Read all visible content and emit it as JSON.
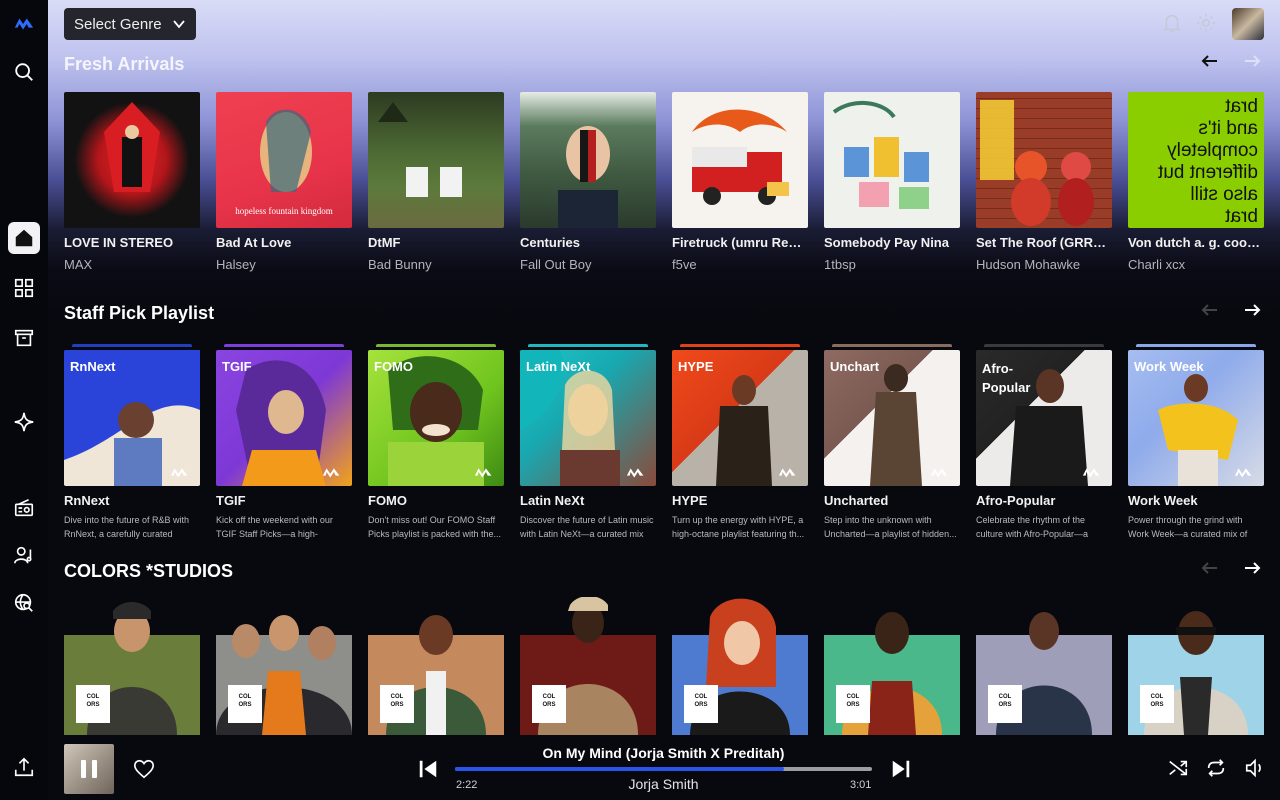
{
  "header": {
    "genre_select": "Select Genre"
  },
  "icons": {
    "logo": "logo-icon",
    "search": "search-icon",
    "home": "home-icon",
    "grid": "grid-icon",
    "archive": "archive-icon",
    "sparkle": "sparkle-icon",
    "radio": "radio-icon",
    "artists": "artist-icon",
    "discover": "globe-search-icon",
    "upload": "upload-icon",
    "bell": "bell-icon",
    "settings": "gear-icon"
  },
  "sections": {
    "fresh": {
      "title": "Fresh Arrivals",
      "items": [
        {
          "title": "LOVE IN STEREO",
          "artist": "MAX"
        },
        {
          "title": "Bad At Love",
          "artist": "Halsey"
        },
        {
          "title": "DtMF",
          "artist": "Bad Bunny"
        },
        {
          "title": "Centuries",
          "artist": "Fall Out Boy"
        },
        {
          "title": "Firetruck (umru Remix)",
          "artist": "f5ve"
        },
        {
          "title": "Somebody Pay Nina",
          "artist": "1tbsp"
        },
        {
          "title": "Set The Roof (GRRL Remix)",
          "artist": "Hudson Mohawke"
        },
        {
          "title": "Von dutch a. g. cook remix",
          "artist": "Charli xcx"
        }
      ]
    },
    "staff": {
      "title": "Staff Pick Playlist",
      "items": [
        {
          "tag": "RnNext",
          "title": "RnNext",
          "desc": "Dive into the future of R&B with RnNext, a carefully curated playl..."
        },
        {
          "tag": "TGIF",
          "title": "TGIF",
          "desc": "Kick off the weekend with our TGIF Staff Picks—a high-energy..."
        },
        {
          "tag": "FOMO",
          "title": "FOMO",
          "desc": "Don't miss out! Our FOMO Staff Picks playlist is packed with the..."
        },
        {
          "tag": "Latin NeXt",
          "title": "Latin NeXt",
          "desc": "Discover the future of Latin music with Latin NeXt—a curated mix o..."
        },
        {
          "tag": "HYPE",
          "title": "HYPE",
          "desc": "Turn up the energy with HYPE, a high-octane playlist featuring th..."
        },
        {
          "tag": "Unchart",
          "title": "Uncharted",
          "desc": "Step into the unknown with Uncharted—a playlist of hidden..."
        },
        {
          "tag": "Afro-Popular",
          "title": "Afro-Popular",
          "desc": "Celebrate the rhythm of the culture with Afro-Popular—a vibr..."
        },
        {
          "tag": "Work Week",
          "title": "Work Week",
          "desc": "Power through the grind with Work Week—a curated mix of in..."
        }
      ]
    },
    "colors": {
      "title": "COLORS *STUDIOS",
      "badge_line1": "COL",
      "badge_line2": "ORS"
    }
  },
  "player": {
    "track": "On My Mind (Jorja Smith X Preditah)",
    "artist": "Jorja Smith",
    "elapsed": "2:22",
    "duration": "3:01",
    "progress": 0.79
  },
  "colors": {
    "accent": "#2a55e8",
    "logo": "#2f6bff"
  }
}
